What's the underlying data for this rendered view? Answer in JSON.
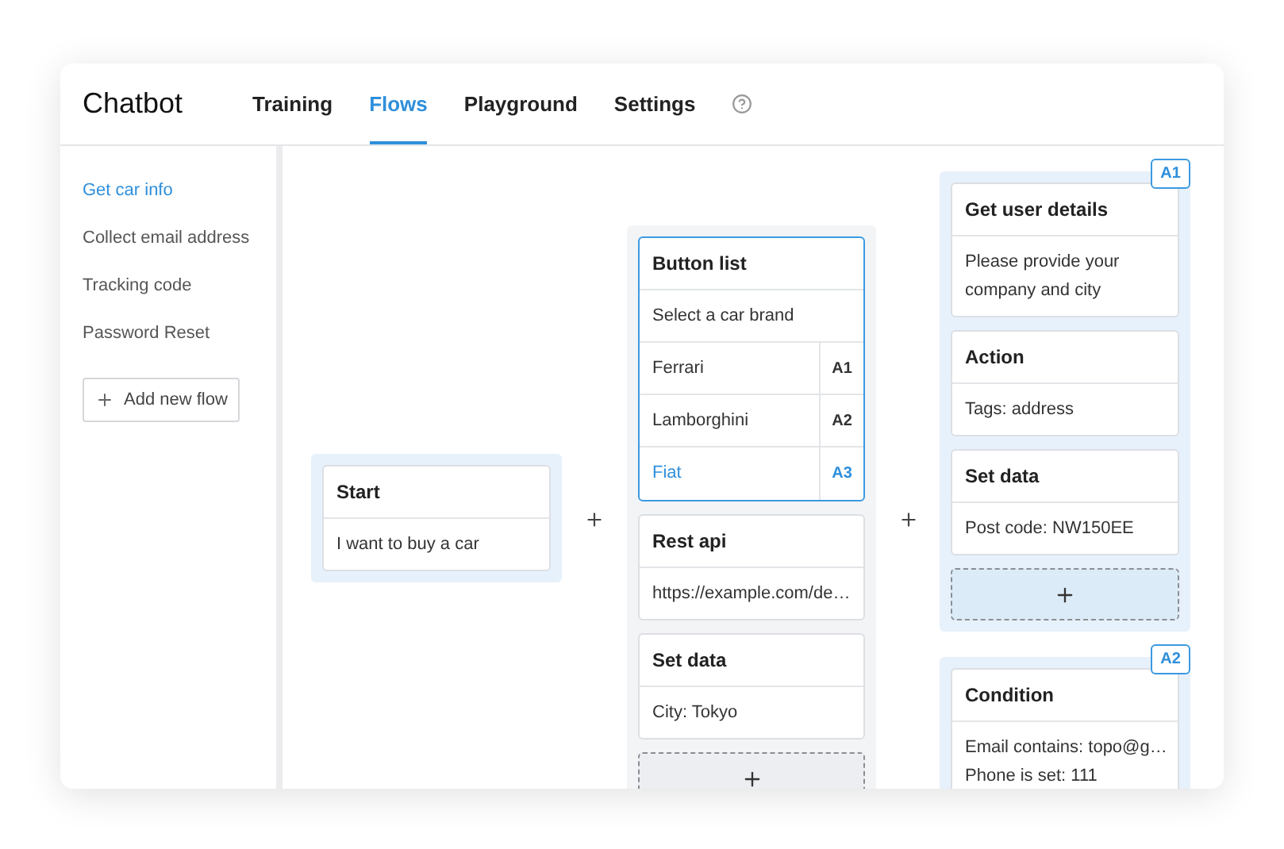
{
  "app": {
    "title": "Chatbot"
  },
  "tabs": [
    {
      "label": "Training",
      "selected": false
    },
    {
      "label": "Flows",
      "selected": true
    },
    {
      "label": "Playground",
      "selected": false
    },
    {
      "label": "Settings",
      "selected": false
    }
  ],
  "sidebar": {
    "flows": [
      {
        "label": "Get car info",
        "selected": true
      },
      {
        "label": "Collect email address",
        "selected": false
      },
      {
        "label": "Tracking code",
        "selected": false
      },
      {
        "label": "Password Reset",
        "selected": false
      }
    ],
    "add_button": "Add new flow"
  },
  "canvas": {
    "groups": [
      {
        "highlighted": true,
        "add_slot": false,
        "cards": [
          {
            "title": "Start",
            "selected": false,
            "lines": [
              "I want to buy a car"
            ]
          }
        ]
      },
      {
        "highlighted": false,
        "add_slot": true,
        "cards": [
          {
            "title": "Button list",
            "selected": true,
            "lines": [
              "Select a car brand"
            ],
            "buttons": [
              {
                "label": "Ferrari",
                "tag": "A1",
                "selected": false
              },
              {
                "label": "Lamborghini",
                "tag": "A2",
                "selected": false
              },
              {
                "label": "Fiat",
                "tag": "A3",
                "selected": true
              }
            ]
          },
          {
            "title": "Rest api",
            "selected": false,
            "lines": [
              "https://example.com/de…"
            ]
          },
          {
            "title": "Set data",
            "selected": false,
            "lines": [
              "City: Tokyo"
            ]
          }
        ]
      },
      {
        "highlighted": true,
        "add_slot": true,
        "badge": "A1",
        "cards": [
          {
            "title": "Get user details",
            "selected": false,
            "lines": [
              "Please provide your",
              "company and city"
            ]
          },
          {
            "title": "Action",
            "selected": false,
            "lines": [
              "Tags: address"
            ]
          },
          {
            "title": "Set data",
            "selected": false,
            "lines": [
              "Post code: NW150EE"
            ]
          }
        ]
      },
      {
        "highlighted": true,
        "add_slot": false,
        "badge": "A2",
        "cards": [
          {
            "title": "Condition",
            "selected": false,
            "lines": [
              "Email contains: topo@g…",
              "Phone is set: 111"
            ]
          }
        ]
      }
    ]
  }
}
